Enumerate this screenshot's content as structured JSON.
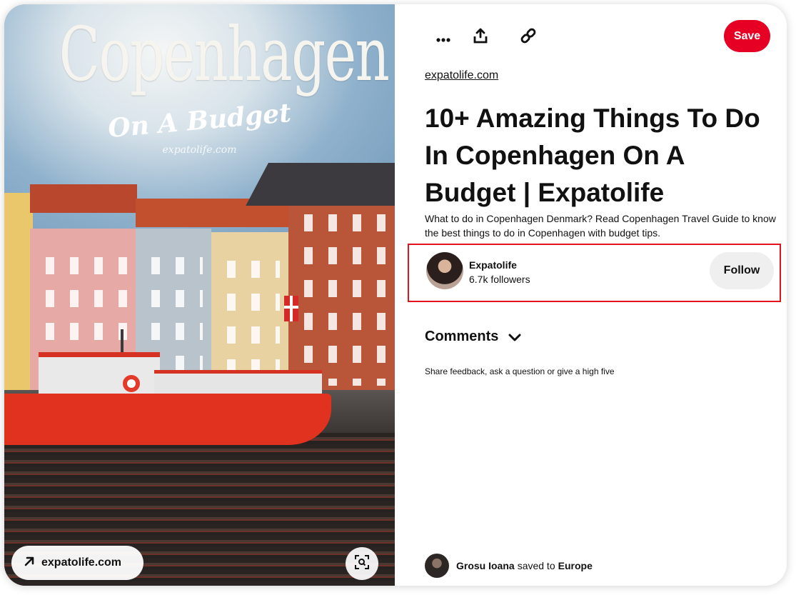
{
  "pin": {
    "image": {
      "title_text": "Copenhagen",
      "subtitle_text": "On A Budget",
      "watermark_text": "expatolife.com",
      "domain_chip": "expatolife.com"
    },
    "toolbar": {
      "more_icon": "more-dots-icon",
      "share_icon": "share-icon",
      "link_icon": "link-icon",
      "save_label": "Save",
      "save_color": "#e60023"
    },
    "source": "expatolife.com",
    "title": "10+ Amazing Things To Do In Copenhagen On A Budget | Expatolife",
    "description": "What to do in Copenhagen Denmark? Read Copenhagen Travel Guide to know the best things to do in Copenhagen with budget tips.",
    "creator": {
      "name": "Expatolife",
      "followers": "6.7k followers",
      "follow_label": "Follow",
      "highlight_color": "#e0141e"
    },
    "comments": {
      "heading": "Comments",
      "hint": "Share feedback, ask a question or give a high five"
    },
    "saved_by": {
      "user": "Grosu Ioana",
      "verb": "saved to",
      "board": "Europe"
    }
  }
}
